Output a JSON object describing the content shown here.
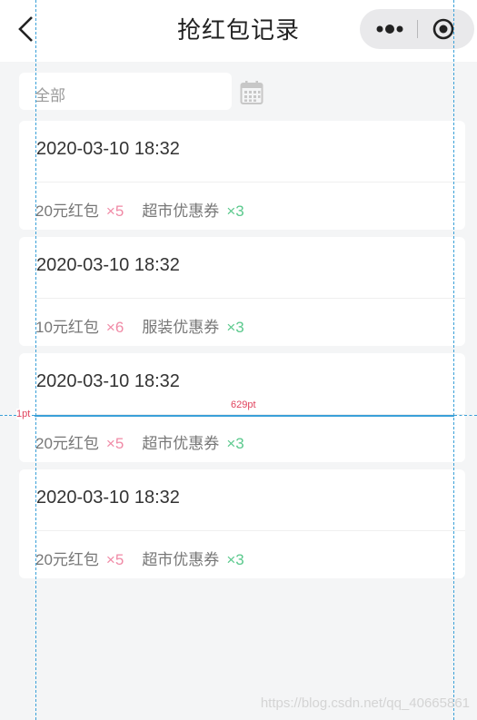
{
  "header": {
    "title": "抢红包记录",
    "back_icon": "chevron-left-icon",
    "more_icon": "more-dots-icon",
    "close_icon": "target-circle-icon"
  },
  "filter": {
    "label": "全部",
    "calendar_icon": "calendar-icon"
  },
  "records": [
    {
      "time": "2020-03-10 18:32",
      "items": [
        {
          "name": "20元红包",
          "qty": "×5"
        },
        {
          "name": "超市优惠券",
          "qty": "×3"
        }
      ]
    },
    {
      "time": "2020-03-10 18:32",
      "items": [
        {
          "name": "10元红包",
          "qty": "×6"
        },
        {
          "name": "服装优惠券",
          "qty": "×3"
        }
      ]
    },
    {
      "time": "2020-03-10 18:32",
      "items": [
        {
          "name": "20元红包",
          "qty": "×5"
        },
        {
          "name": "超市优惠券",
          "qty": "×3"
        }
      ]
    },
    {
      "time": "2020-03-10 18:32",
      "items": [
        {
          "name": "20元红包",
          "qty": "×5"
        },
        {
          "name": "超市优惠券",
          "qty": "×3"
        }
      ]
    }
  ],
  "measurements": {
    "left_label": "1pt",
    "width_label": "629pt"
  },
  "watermark": "https://blog.csdn.net/qq_40665861",
  "colors": {
    "red_packet_qty": "#f08aa6",
    "coupon_qty": "#5bc98d",
    "guide_line": "#3aa0d8",
    "measure_text": "#e0435d"
  }
}
